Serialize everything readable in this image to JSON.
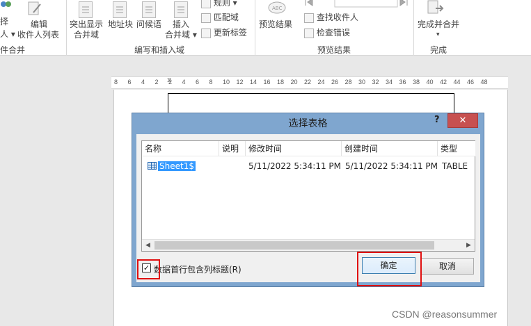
{
  "ribbon": {
    "left_partial_labels": [
      "择",
      "人"
    ],
    "edit_recipients": [
      "编辑",
      "收件人列表"
    ],
    "group_start_label": "件合并",
    "highlight_fields": [
      "突出显示",
      "合并域"
    ],
    "address_block": "地址块",
    "greeting_line": "问候语",
    "insert_field": [
      "插入",
      "合并域"
    ],
    "rules": "规则",
    "match_fields": "匹配域",
    "update_labels": "更新标签",
    "group_write_label": "编写和插入域",
    "preview_results": "预览结果",
    "find_recipient": "查找收件人",
    "check_errors": "检查错误",
    "group_preview_label": "预览结果",
    "finish_merge": "完成并合并",
    "group_finish_label": "完成"
  },
  "ruler": {
    "ticks": [
      "8",
      "6",
      "4",
      "2",
      "2",
      "4",
      "6",
      "8",
      "10",
      "12",
      "14",
      "16",
      "18",
      "20",
      "22",
      "24",
      "26",
      "28",
      "30",
      "32",
      "34",
      "36",
      "38",
      "40",
      "42",
      "44",
      "46",
      "48"
    ]
  },
  "dialog": {
    "title": "选择表格",
    "help": "?",
    "close": "✕",
    "columns": [
      "名称",
      "说明",
      "修改时间",
      "创建时间",
      "类型"
    ],
    "rows": [
      {
        "name": "Sheet1$",
        "description": "",
        "modified": "5/11/2022 5:34:11 PM",
        "created": "5/11/2022 5:34:11 PM",
        "type": "TABLE"
      }
    ],
    "checkbox_checked": true,
    "checkbox_label": "数据首行包含列标题(R)",
    "ok_label": "确定",
    "cancel_label": "取消"
  },
  "watermark": "CSDN @reasonsummer",
  "colors": {
    "dialog_frame": "#7fa6cf",
    "close_button": "#c75050",
    "selection": "#3399ff",
    "highlight_box": "#e01010"
  }
}
